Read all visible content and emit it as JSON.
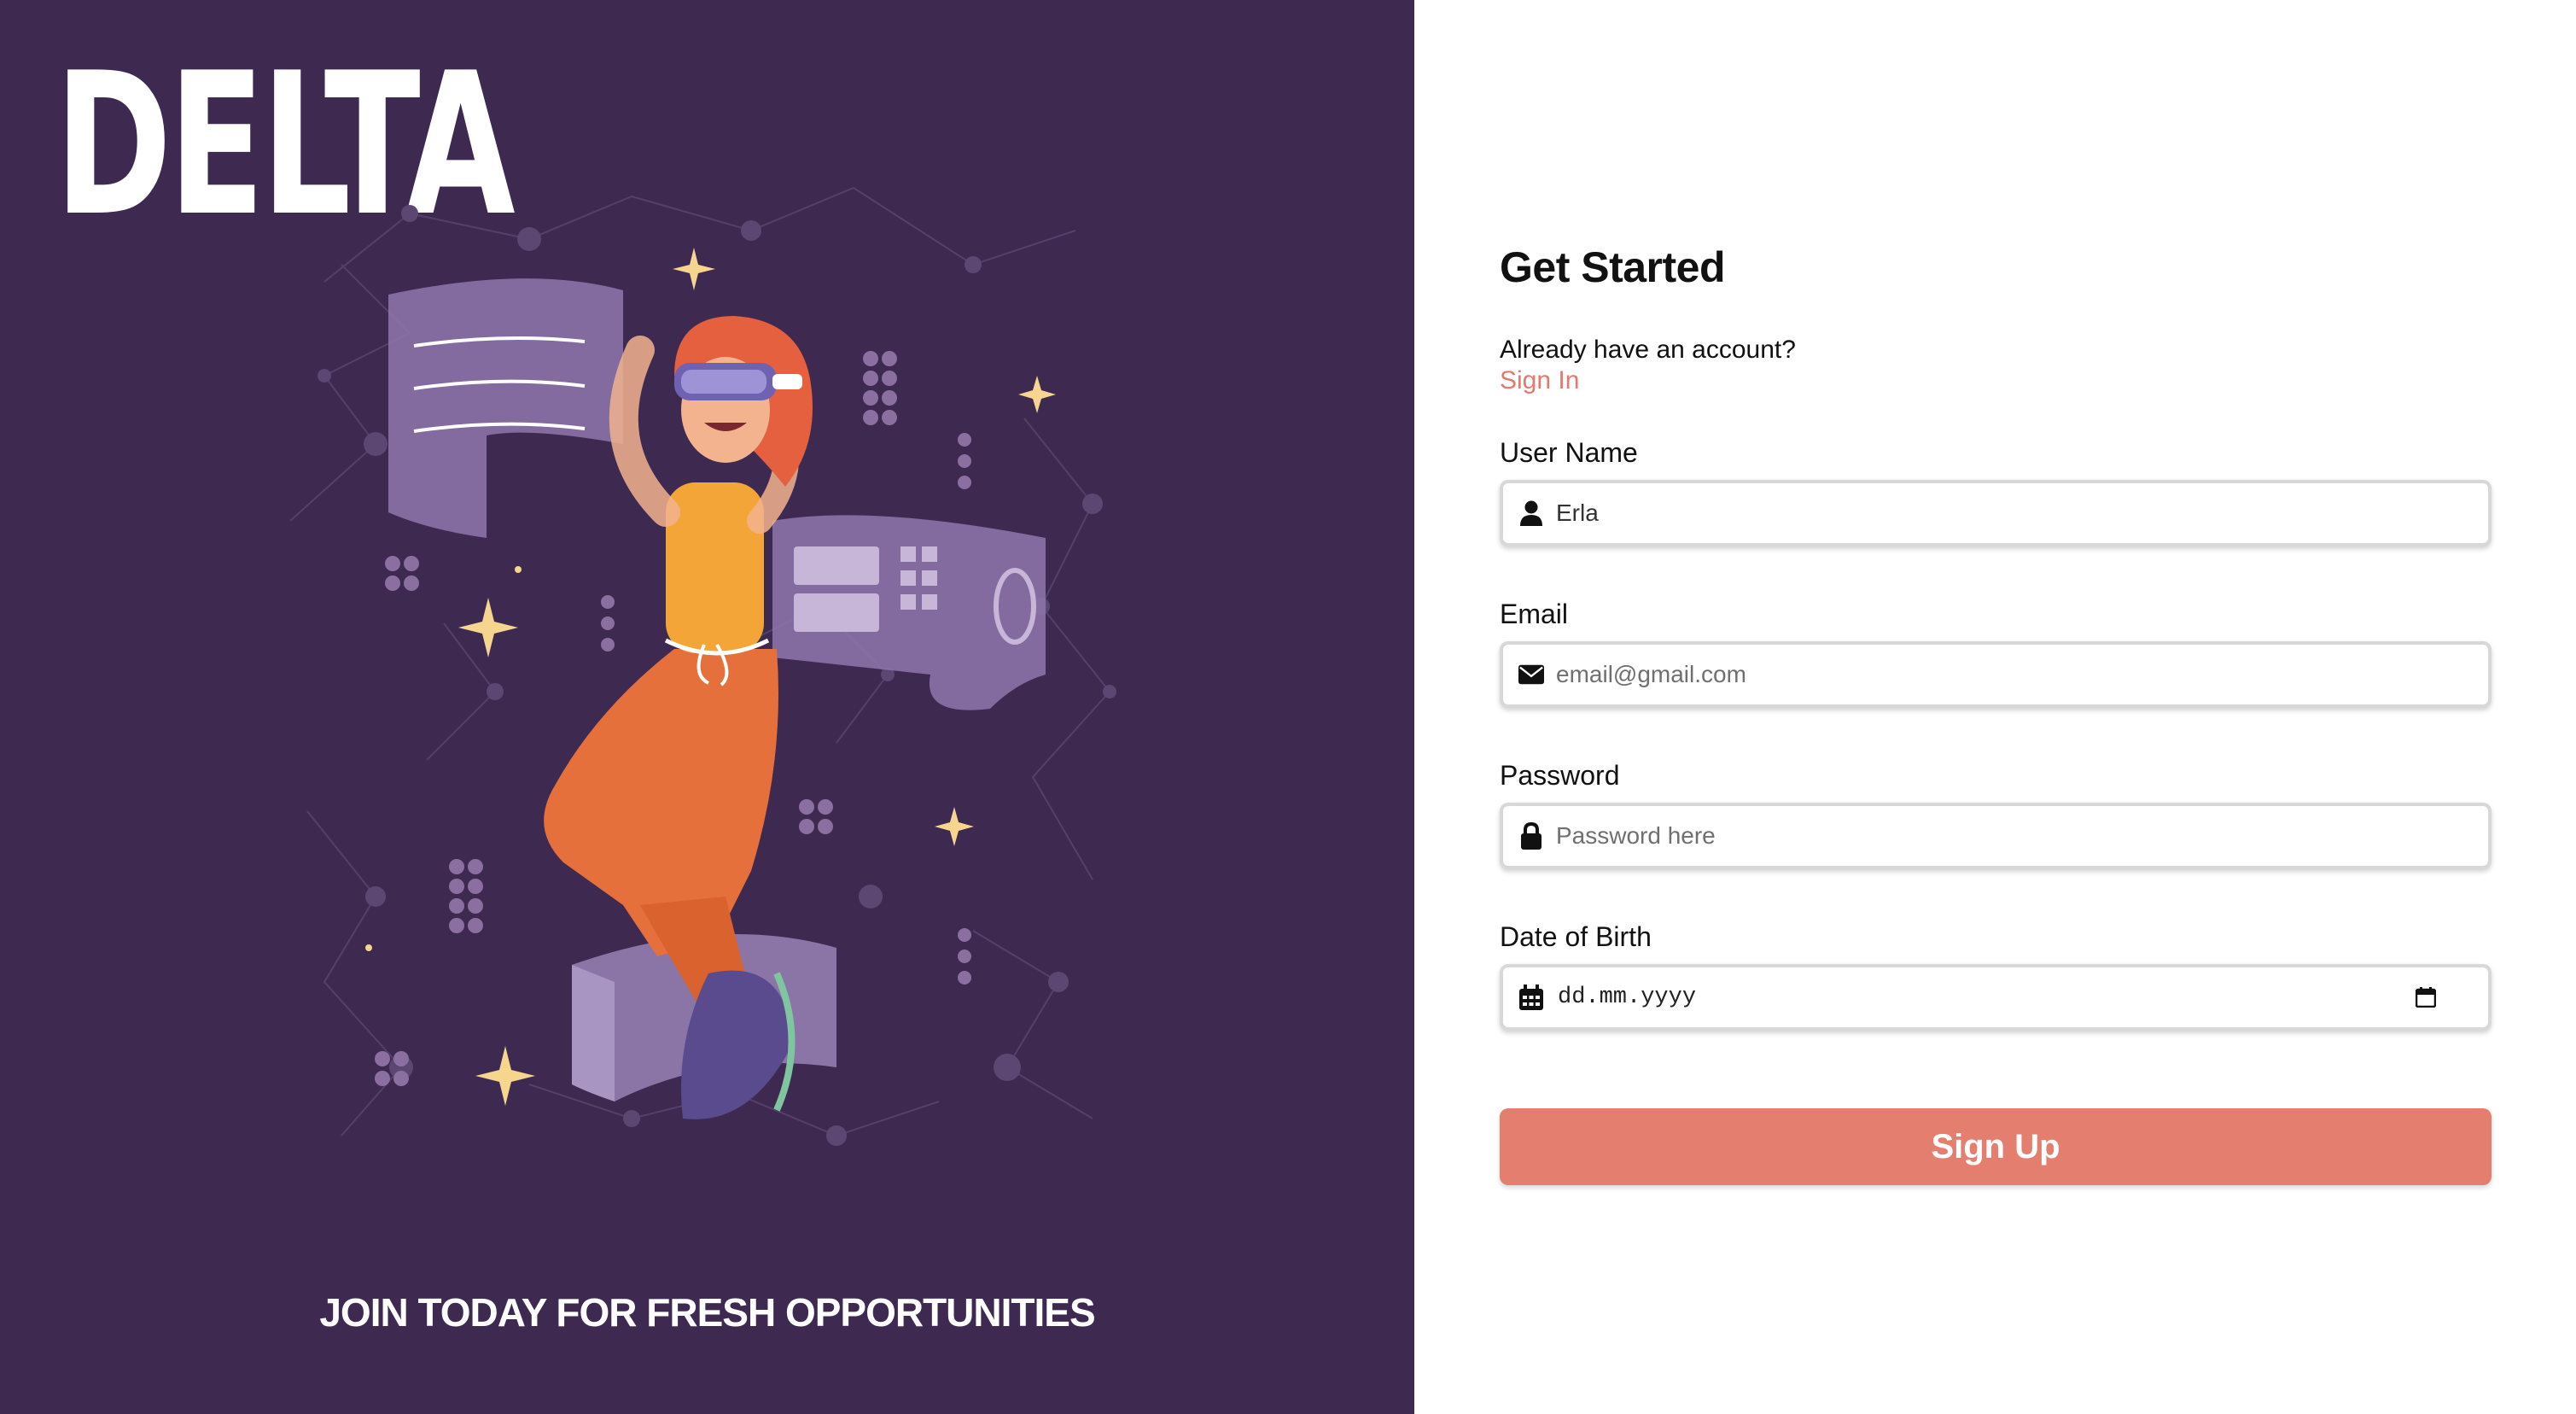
{
  "brand": {
    "logo_text": "DELTA",
    "tagline": "JOIN TODAY FOR FRESH OPPORTUNITIES"
  },
  "form": {
    "title": "Get Started",
    "already_text": "Already have an account?",
    "signin_label": "Sign In",
    "username": {
      "label": "User Name",
      "value": "Erla",
      "icon": "user-icon"
    },
    "email": {
      "label": "Email",
      "placeholder": "email@gmail.com",
      "icon": "envelope-icon"
    },
    "password": {
      "label": "Password",
      "placeholder": "Password here",
      "icon": "lock-icon"
    },
    "dob": {
      "label": "Date of Birth",
      "placeholder": "dd.mm.yyyy",
      "icon": "calendar-icon"
    },
    "submit_label": "Sign Up"
  },
  "colors": {
    "left_bg": "#3e2a51",
    "accent": "#e47f70",
    "link": "#e27a6e"
  }
}
